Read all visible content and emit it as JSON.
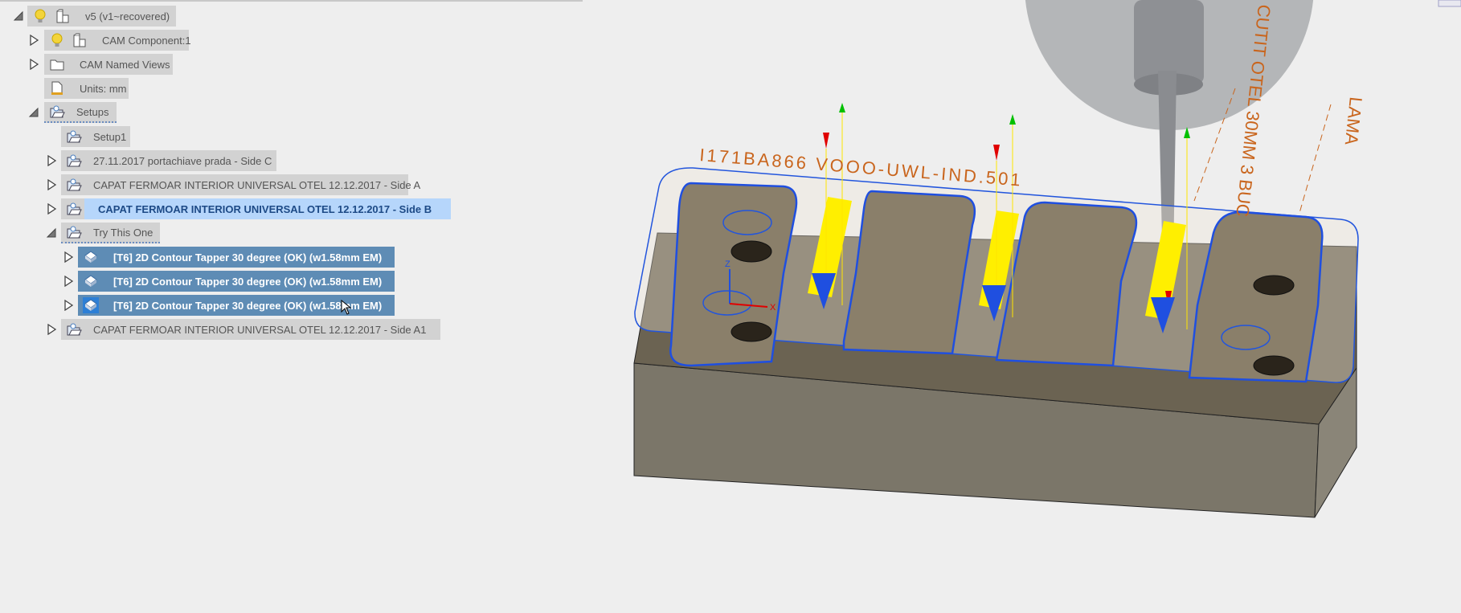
{
  "browser": {
    "root": {
      "label": "v5 (v1~recovered)",
      "expanded": true
    },
    "items": [
      {
        "label": "CAM Component:1",
        "icon": "component-icon"
      },
      {
        "label": "CAM Named Views",
        "icon": "folder-icon"
      },
      {
        "label": "Units: mm",
        "icon": "units-document-icon"
      },
      {
        "label": "Setups",
        "icon": "setup-folder-icon",
        "expanded": true
      }
    ],
    "setups": [
      {
        "label": "Setup1"
      },
      {
        "label": "27.11.2017 portachiave prada - Side C"
      },
      {
        "label": "CAPAT FERMOAR INTERIOR UNIVERSAL OTEL 12.12.2017 - Side A"
      },
      {
        "label": "CAPAT FERMOAR INTERIOR UNIVERSAL OTEL 12.12.2017 - Side B",
        "state": "highlighted"
      },
      {
        "label": "Try This One",
        "expanded": true
      },
      {
        "label": "CAPAT FERMOAR INTERIOR UNIVERSAL OTEL 12.12.2017 - Side A1"
      }
    ],
    "operations": [
      {
        "label": "[T6] 2D Contour Tapper 30 degree (OK) (w1.58mm EM)",
        "selected": true
      },
      {
        "label": "[T6] 2D Contour Tapper 30 degree (OK) (w1.58mm EM)",
        "selected": true
      },
      {
        "label": "[T6] 2D Contour Tapper 30 degree (OK) (w1.58mm EM)",
        "selected": true
      }
    ]
  },
  "viewport": {
    "annotations": {
      "engraving": "I171BA866 VOOO-UWL-IND.501",
      "note1": "CUTIT OTEL 30MM 3 BUC",
      "note2": "LAMA"
    },
    "axis_labels": {
      "z": "Z",
      "x": "X"
    }
  },
  "colors": {
    "selection": "#5e8cb5",
    "highlight": "#b6d6fb",
    "annotation": "#c9651d",
    "toolpath": "#1f4fe0",
    "stock": "#716a5e"
  }
}
